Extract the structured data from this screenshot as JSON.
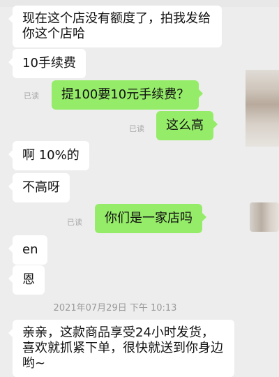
{
  "header": {
    "title": ""
  },
  "messages": [
    {
      "side": "in",
      "text": "现在这个店没有额度了，拍我发给你这个店哈"
    },
    {
      "side": "in",
      "text": "10手续费"
    },
    {
      "side": "out",
      "text": "提100要10元手续费？",
      "status": "已读"
    },
    {
      "side": "out",
      "text": "这么高",
      "status": "已读"
    },
    {
      "side": "in",
      "text": "啊 10%的"
    },
    {
      "side": "in",
      "text": "不高呀"
    },
    {
      "side": "out",
      "text": "你们是一家店吗",
      "status": "已读"
    },
    {
      "side": "in",
      "text": "en"
    },
    {
      "side": "in",
      "text": "恩"
    },
    {
      "side": "in",
      "text": "亲亲，这款商品享受24小时发货，喜欢就抓紧下单，很快就送到你身边哟~"
    }
  ],
  "timestamp": "2021年07月29日 下午 10:13"
}
